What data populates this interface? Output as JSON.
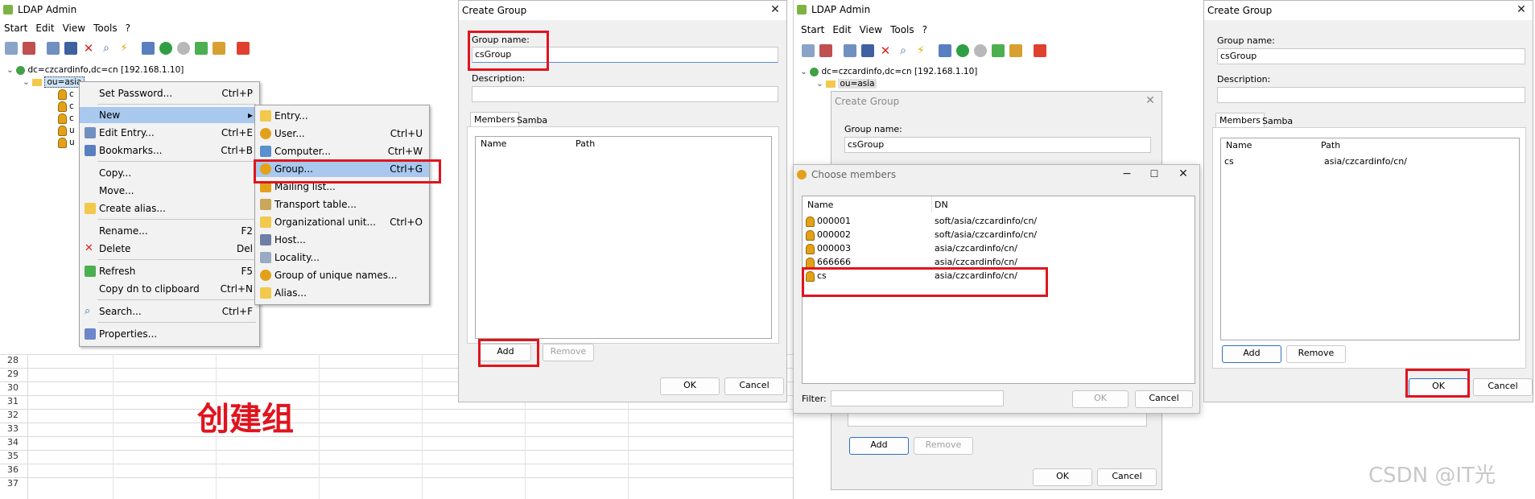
{
  "ldap1": {
    "title": "LDAP Admin",
    "menu": [
      "Start",
      "Edit",
      "View",
      "Tools",
      "?"
    ],
    "tree": {
      "root": "dc=czcardinfo,dc=cn [192.168.1.10]",
      "ou": "ou=asia",
      "children": [
        "c",
        "c",
        "c",
        "u",
        "u"
      ]
    }
  },
  "context_menu": {
    "items": [
      {
        "label": "Set Password...",
        "shortcut": "Ctrl+P"
      },
      {
        "label": "New",
        "shortcut": "▸"
      },
      {
        "label": "Edit Entry...",
        "shortcut": "Ctrl+E"
      },
      {
        "label": "Bookmarks...",
        "shortcut": "Ctrl+B"
      },
      {
        "label": "Copy...",
        "shortcut": ""
      },
      {
        "label": "Move...",
        "shortcut": ""
      },
      {
        "label": "Create alias...",
        "shortcut": ""
      },
      {
        "label": "Rename...",
        "shortcut": "F2"
      },
      {
        "label": "Delete",
        "shortcut": "Del"
      },
      {
        "label": "Refresh",
        "shortcut": "F5"
      },
      {
        "label": "Copy dn to clipboard",
        "shortcut": "Ctrl+N"
      },
      {
        "label": "Search...",
        "shortcut": "Ctrl+F"
      },
      {
        "label": "Properties...",
        "shortcut": ""
      }
    ]
  },
  "submenu": {
    "items": [
      {
        "label": "Entry...",
        "shortcut": ""
      },
      {
        "label": "User...",
        "shortcut": "Ctrl+U"
      },
      {
        "label": "Computer...",
        "shortcut": "Ctrl+W"
      },
      {
        "label": "Group...",
        "shortcut": "Ctrl+G"
      },
      {
        "label": "Mailing list...",
        "shortcut": ""
      },
      {
        "label": "Transport table...",
        "shortcut": ""
      },
      {
        "label": "Organizational unit...",
        "shortcut": "Ctrl+O"
      },
      {
        "label": "Host...",
        "shortcut": ""
      },
      {
        "label": "Locality...",
        "shortcut": ""
      },
      {
        "label": "Group of unique names...",
        "shortcut": ""
      },
      {
        "label": "Alias...",
        "shortcut": ""
      }
    ]
  },
  "spreadsheet": {
    "rows": [
      "28",
      "29",
      "30",
      "31",
      "32",
      "33",
      "34",
      "35",
      "36",
      "37"
    ]
  },
  "caption": "创建组",
  "create_group": {
    "title": "Create Group",
    "group_name_label": "Group name:",
    "group_name_value": "csGroup",
    "description_label": "Description:",
    "tabs": [
      "Members",
      "Samba"
    ],
    "col_name": "Name",
    "col_path": "Path",
    "add": "Add",
    "remove": "Remove",
    "ok": "OK",
    "cancel": "Cancel"
  },
  "ldap2": {
    "title": "LDAP Admin",
    "root": "dc=czcardinfo,dc=cn [192.168.1.10]",
    "ou": "ou=asia"
  },
  "choose_members": {
    "title": "Choose members",
    "col_name": "Name",
    "col_dn": "DN",
    "rows": [
      {
        "name": "000001",
        "dn": "soft/asia/czcardinfo/cn/"
      },
      {
        "name": "000002",
        "dn": "soft/asia/czcardinfo/cn/"
      },
      {
        "name": "000003",
        "dn": "asia/czcardinfo/cn/"
      },
      {
        "name": "666666",
        "dn": "asia/czcardinfo/cn/"
      },
      {
        "name": "cs",
        "dn": "asia/czcardinfo/cn/"
      }
    ],
    "filter_label": "Filter:",
    "ok": "OK",
    "cancel": "Cancel"
  },
  "create_group_final": {
    "member_name": "cs",
    "member_path": "asia/czcardinfo/cn/"
  },
  "watermark": "CSDN @IT光"
}
